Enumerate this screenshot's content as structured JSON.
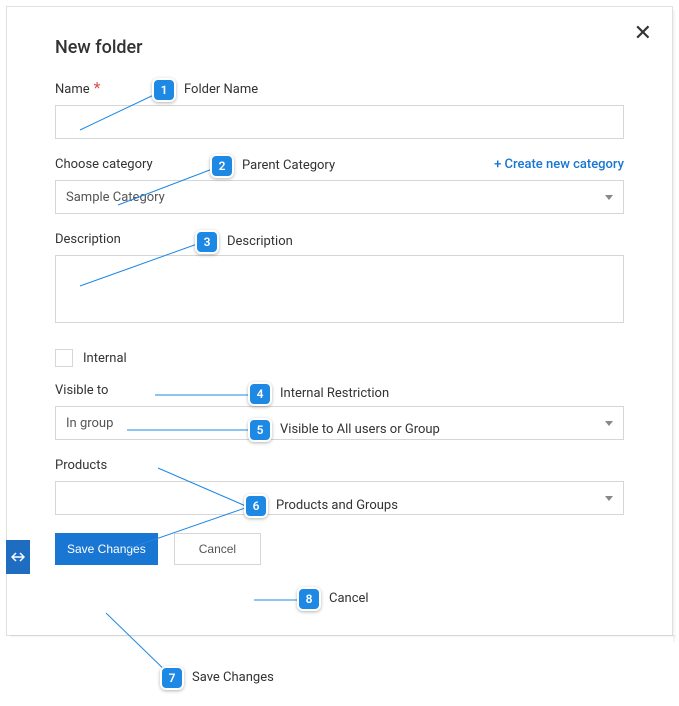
{
  "title": "New folder",
  "closeIcon": "✕",
  "fields": {
    "name": {
      "label": "Name",
      "required": "*",
      "value": ""
    },
    "category": {
      "label": "Choose category",
      "createLink": "+ Create new category",
      "value": "Sample Category"
    },
    "description": {
      "label": "Description",
      "value": ""
    },
    "internal": {
      "label": "Internal",
      "checked": false
    },
    "visible": {
      "label": "Visible to",
      "value": "In group"
    },
    "products": {
      "label": "Products",
      "value": ""
    }
  },
  "buttons": {
    "save": "Save Changes",
    "cancel": "Cancel"
  },
  "annotations": {
    "1": "Folder Name",
    "2": "Parent Category",
    "3": "Description",
    "4": "Internal Restriction",
    "5": "Visible to All users or Group",
    "6": "Products and Groups",
    "7": "Save Changes",
    "8": "Cancel"
  }
}
